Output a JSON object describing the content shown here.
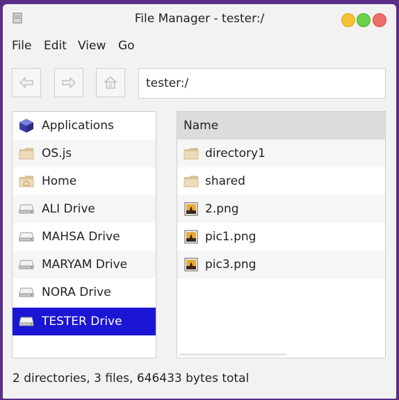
{
  "window": {
    "title": "File Manager - tester:/"
  },
  "menu": [
    "File",
    "Edit",
    "View",
    "Go"
  ],
  "toolbar": {
    "address": "tester:/"
  },
  "sidebar": {
    "items": [
      {
        "label": "Applications",
        "icon": "applications-icon"
      },
      {
        "label": "OS.js",
        "icon": "folder-icon"
      },
      {
        "label": "Home",
        "icon": "home-folder-icon"
      },
      {
        "label": "ALI Drive",
        "icon": "drive-icon"
      },
      {
        "label": "MAHSA Drive",
        "icon": "drive-icon"
      },
      {
        "label": "MARYAM Drive",
        "icon": "drive-icon"
      },
      {
        "label": "NORA Drive",
        "icon": "drive-icon"
      },
      {
        "label": "TESTER Drive",
        "icon": "drive-icon",
        "selected": true
      }
    ]
  },
  "filelist": {
    "column": "Name",
    "rows": [
      {
        "name": "directory1",
        "icon": "folder-icon"
      },
      {
        "name": "shared",
        "icon": "folder-icon"
      },
      {
        "name": "2.png",
        "icon": "image-icon"
      },
      {
        "name": "pic1.png",
        "icon": "image-icon"
      },
      {
        "name": "pic3.png",
        "icon": "image-icon"
      }
    ]
  },
  "status": "2 directories, 3 files, 646433 bytes total"
}
